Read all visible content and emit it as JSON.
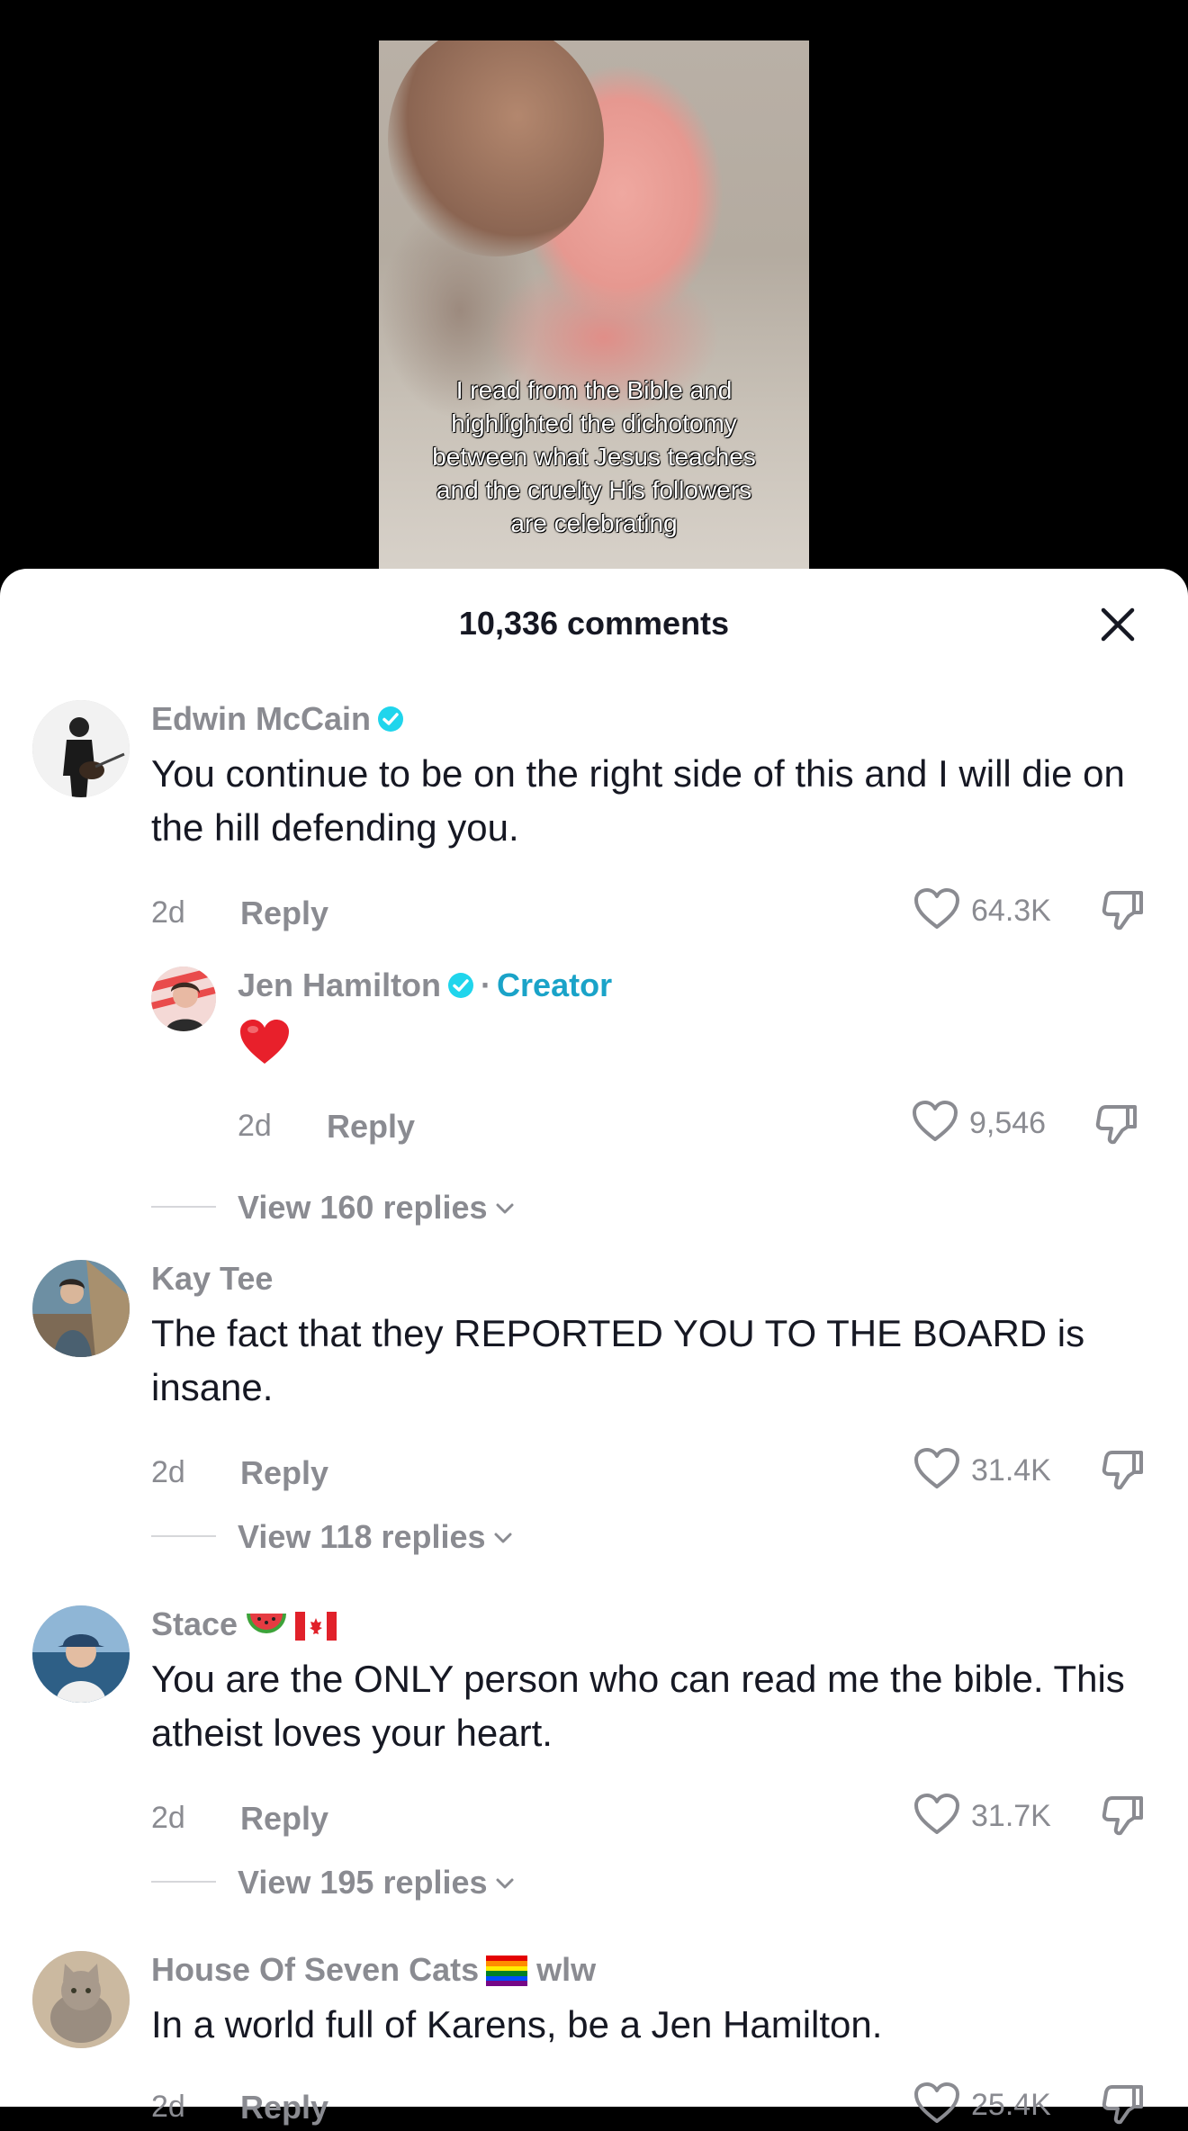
{
  "video": {
    "caption": "I read from the Bible and\nhighlighted the dichotomy\nbetween what Jesus teaches\nand the cruelty His followers\nare celebrating"
  },
  "comments_panel": {
    "title": "10,336 comments",
    "close_icon": "close-icon"
  },
  "comments": [
    {
      "username": "Edwin McCain",
      "verified": true,
      "text": "You continue to be on the right side of this and I will die on the hill defending you.",
      "time": "2d",
      "reply_label": "Reply",
      "likes": "64.3K",
      "reply": {
        "username": "Jen Hamilton",
        "verified": true,
        "badge_separator": "·",
        "badge": "Creator",
        "text_icon": "red-heart-emoji",
        "time": "2d",
        "reply_label": "Reply",
        "likes": "9,546"
      },
      "view_replies": "View 160 replies"
    },
    {
      "username": "Kay Tee",
      "text": "The fact that they REPORTED YOU TO THE BOARD is insane.",
      "time": "2d",
      "reply_label": "Reply",
      "likes": "31.4K",
      "view_replies": "View 118 replies"
    },
    {
      "username": "Stace",
      "username_emojis": [
        "watermelon-emoji",
        "canada-flag-emoji"
      ],
      "text": "You are the ONLY person who can read me the bible. This atheist loves your heart.",
      "time": "2d",
      "reply_label": "Reply",
      "likes": "31.7K",
      "view_replies": "View 195 replies"
    },
    {
      "username": "House Of Seven Cats",
      "username_emojis": [
        "rainbow-flag-emoji"
      ],
      "username_suffix": "wlw",
      "text": "In a world full of Karens, be a Jen Hamilton.",
      "time": "2d",
      "reply_label": "Reply",
      "likes": "25.4K"
    }
  ],
  "colors": {
    "text_primary": "#161823",
    "text_secondary": "#8a8b91",
    "verified": "#20d5ec",
    "creator": "#1aa3c8",
    "heart_emoji": "#e8202b"
  }
}
